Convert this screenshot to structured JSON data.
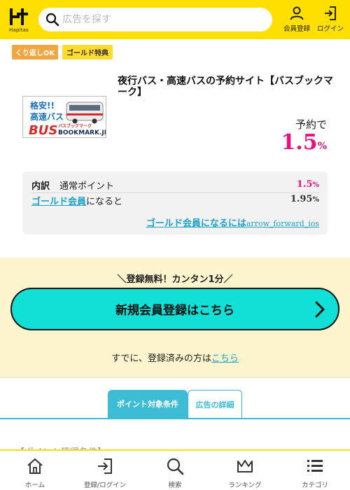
{
  "header": {
    "logo_text": "Hapitas",
    "search_placeholder": "広告を探す",
    "member_label": "会員登録",
    "login_label": "ログイン"
  },
  "badges": {
    "repeat": "くり返しOK",
    "gold": "ゴールド特典"
  },
  "ad": {
    "image_lines": [
      "格安!!",
      "高速バス",
      "BUS",
      "バスブックマーク",
      "BOOKMARK.JP"
    ],
    "title": "夜行バス・高速バスの予約サイト【バスブックマーク】",
    "reserve_label": "予約で",
    "reserve_value": "1.5",
    "reserve_unit": "%"
  },
  "breakdown": {
    "label": "内訳",
    "normal_label": "通常ポイント",
    "normal_value": "1.5",
    "normal_unit": "%",
    "gold_link": "ゴールド会員",
    "gold_suffix": "になると",
    "gold_value": "1.95",
    "gold_unit": "%",
    "become_gold": "ゴールド会員になるには",
    "become_gold_icon": "arrow_forward_ios"
  },
  "register": {
    "note": "＼登録無料！カンタン1分／",
    "button": "新規会員登録はこちら",
    "already": "すでに、登録済みの方は",
    "here": "こちら"
  },
  "tabs": {
    "active": "ポイント対象条件",
    "inactive": "広告の詳細"
  },
  "condition_title": "【ポイント獲得条件】",
  "bottom_nav": [
    {
      "label": "ホーム",
      "icon": "home-icon"
    },
    {
      "label": "登録/ログイン",
      "icon": "login-icon"
    },
    {
      "label": "検索",
      "icon": "search-icon"
    },
    {
      "label": "ランキング",
      "icon": "crown-icon"
    },
    {
      "label": "カテゴリ",
      "icon": "list-icon"
    }
  ],
  "colors": {
    "brand_yellow": "#ffdf00",
    "accent_pink": "#e6117e",
    "accent_cyan": "#11e0d6",
    "link_blue": "#1fa2c8",
    "tab_blue": "#3cbcd5"
  }
}
